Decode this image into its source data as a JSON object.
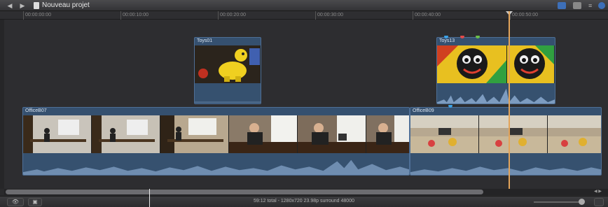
{
  "toolbar": {
    "back_icon": "◀",
    "forward_icon": "▶",
    "project_title": "Nouveau projet",
    "clip_settings_icon": "≡"
  },
  "ruler": {
    "ticks": [
      "00:00:00:00",
      "00:00:10:00",
      "00:00:20:00",
      "00:00:30:00",
      "00:00:40:00",
      "00:00:50:00"
    ]
  },
  "clips": {
    "toys01": {
      "label": "Toys01"
    },
    "toys13": {
      "label": "Toys13"
    },
    "office07": {
      "label": "OfficeB07"
    },
    "office09": {
      "label": "OfficeB09"
    }
  },
  "colors": {
    "clip_border": "#4e6f96",
    "clip_fill": "#35506f",
    "playhead": "#e3a45a",
    "marker_blue": "#3ca3e8",
    "marker_red": "#e24a4a",
    "marker_green": "#6cc04a"
  },
  "status": {
    "summary": "59:12 total - 1280x720 23.98p surround 48000"
  },
  "footer": {
    "view_btn_icon": "👁",
    "screen_btn_icon": "▣"
  }
}
